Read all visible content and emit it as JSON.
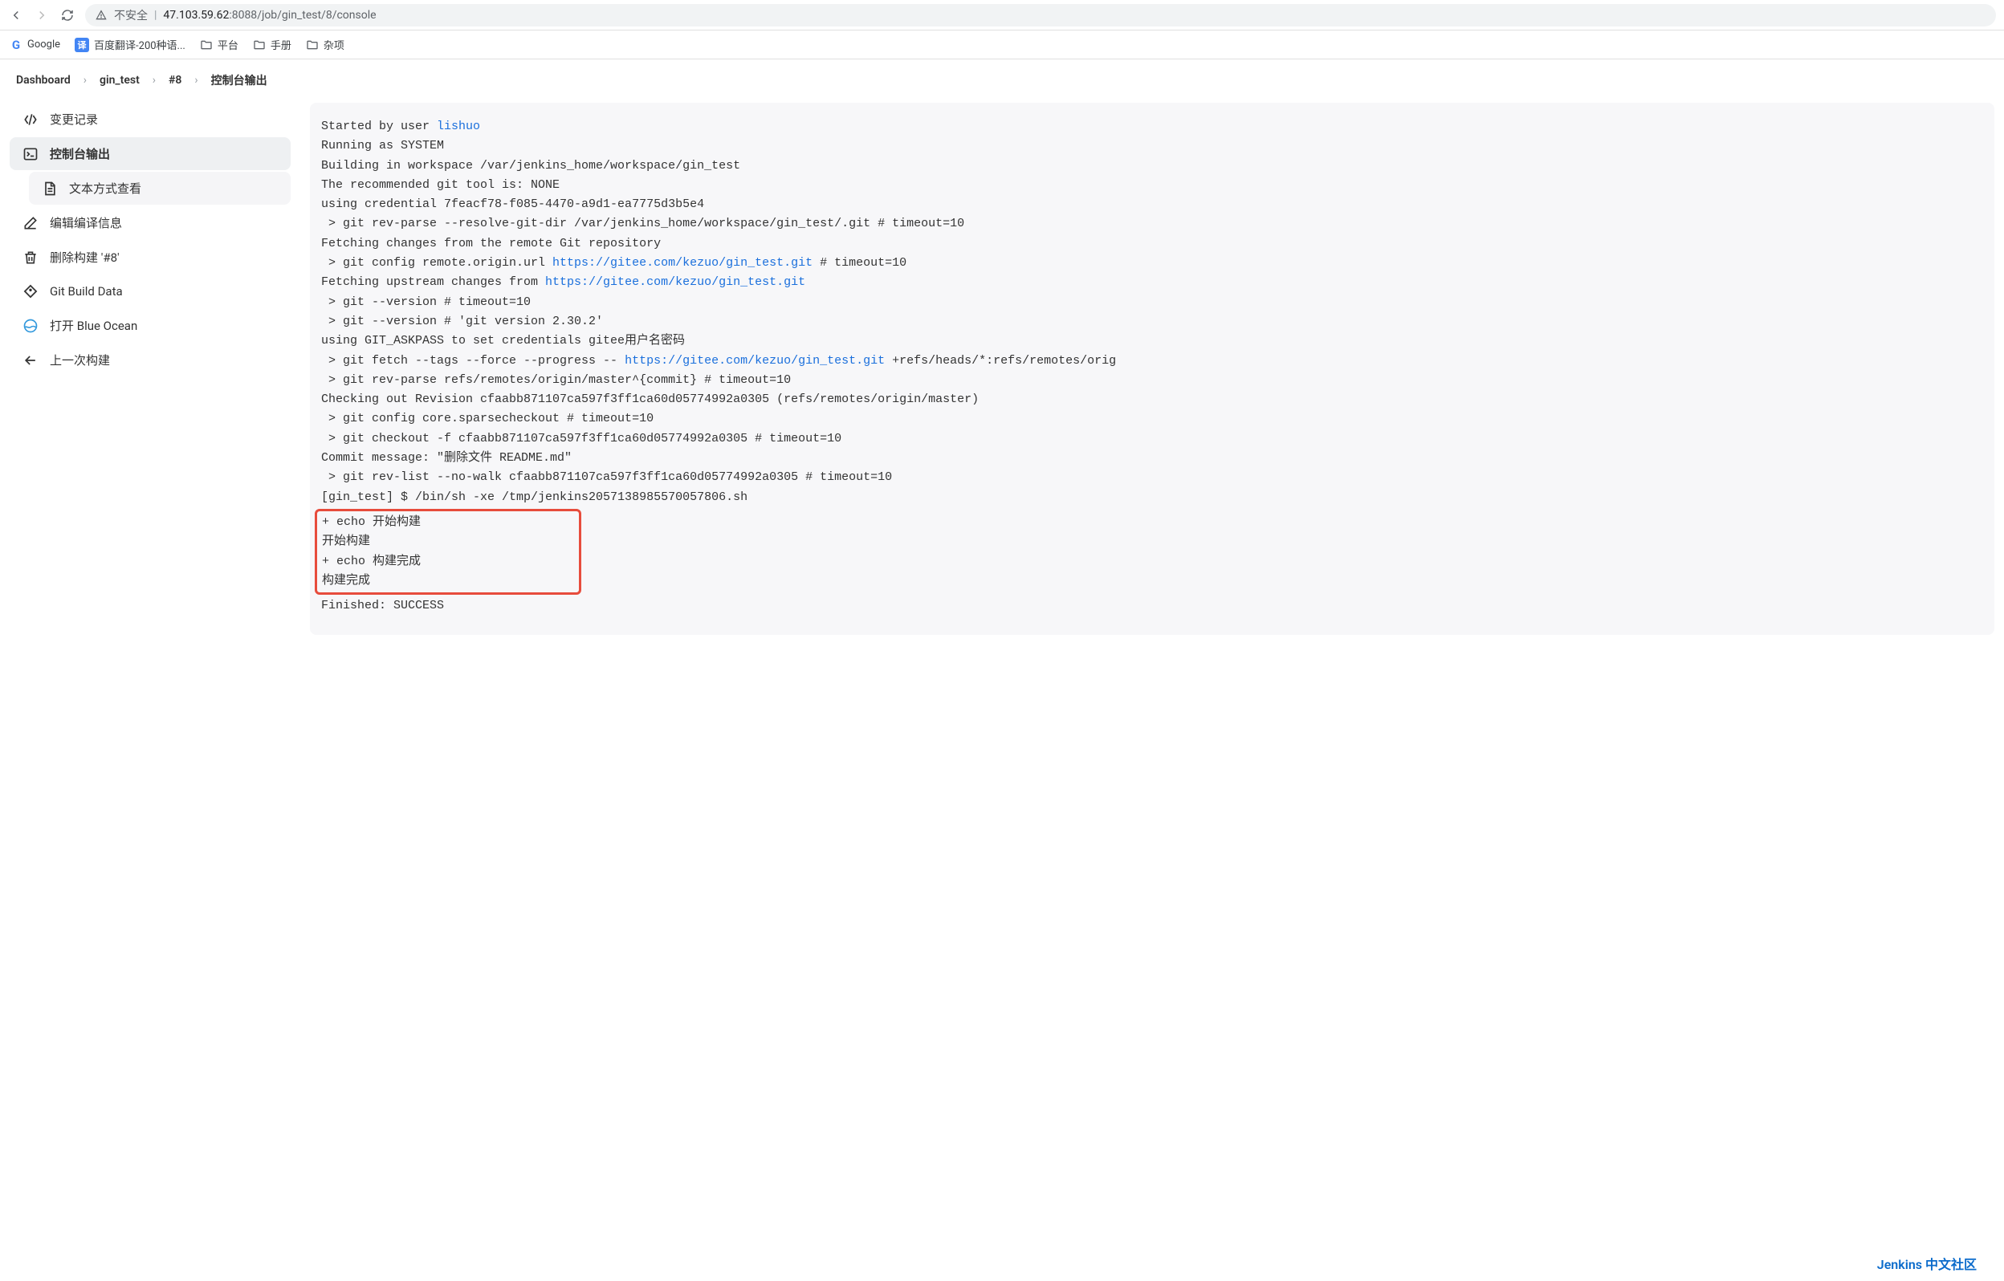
{
  "browser": {
    "insecure_label": "不安全",
    "url_host": "47.103.59.62",
    "url_port": ":8088",
    "url_path": "/job/gin_test/8/console"
  },
  "bookmarks": [
    {
      "kind": "google",
      "label": "Google"
    },
    {
      "kind": "translate",
      "label": "百度翻译-200种语..."
    },
    {
      "kind": "folder",
      "label": "平台"
    },
    {
      "kind": "folder",
      "label": "手册"
    },
    {
      "kind": "folder",
      "label": "杂项"
    }
  ],
  "breadcrumb": [
    "Dashboard",
    "gin_test",
    "#8",
    "控制台输出"
  ],
  "sidebar": [
    {
      "icon": "changes",
      "label": "变更记录"
    },
    {
      "icon": "console",
      "label": "控制台输出",
      "active": true
    },
    {
      "icon": "doc",
      "label": "文本方式查看",
      "sub": true
    },
    {
      "icon": "edit",
      "label": "编辑编译信息"
    },
    {
      "icon": "trash",
      "label": "删除构建 '#8'"
    },
    {
      "icon": "git",
      "label": "Git Build Data"
    },
    {
      "icon": "blueocean",
      "label": "打开 Blue Ocean"
    },
    {
      "icon": "back",
      "label": "上一次构建"
    }
  ],
  "console": {
    "l1_a": "Started by user ",
    "l1_link": "lishuo",
    "l2": "Running as SYSTEM",
    "l3": "Building in workspace /var/jenkins_home/workspace/gin_test",
    "l4": "The recommended git tool is: NONE",
    "l5": "using credential 7feacf78-f085-4470-a9d1-ea7775d3b5e4",
    "l6": " > git rev-parse --resolve-git-dir /var/jenkins_home/workspace/gin_test/.git # timeout=10",
    "l7": "Fetching changes from the remote Git repository",
    "l8_a": " > git config remote.origin.url ",
    "l8_link": "https://gitee.com/kezuo/gin_test.git",
    "l8_b": " # timeout=10",
    "l9_a": "Fetching upstream changes from ",
    "l9_link": "https://gitee.com/kezuo/gin_test.git",
    "l10": " > git --version # timeout=10",
    "l11": " > git --version # 'git version 2.30.2'",
    "l12": "using GIT_ASKPASS to set credentials gitee用户名密码",
    "l13_a": " > git fetch --tags --force --progress -- ",
    "l13_link": "https://gitee.com/kezuo/gin_test.git",
    "l13_b": " +refs/heads/*:refs/remotes/orig",
    "l14": " > git rev-parse refs/remotes/origin/master^{commit} # timeout=10",
    "l15": "Checking out Revision cfaabb871107ca597f3ff1ca60d05774992a0305 (refs/remotes/origin/master)",
    "l16": " > git config core.sparsecheckout # timeout=10",
    "l17": " > git checkout -f cfaabb871107ca597f3ff1ca60d05774992a0305 # timeout=10",
    "l18": "Commit message: \"删除文件 README.md\"",
    "l19": " > git rev-list --no-walk cfaabb871107ca597f3ff1ca60d05774992a0305 # timeout=10",
    "l20": "[gin_test] $ /bin/sh -xe /tmp/jenkins2057138985570057806.sh",
    "hl1": "+ echo 开始构建",
    "hl2": "开始构建",
    "hl3": "+ echo 构建完成",
    "hl4": "构建完成",
    "l25": "Finished: SUCCESS"
  },
  "footer": "Jenkins 中文社区"
}
